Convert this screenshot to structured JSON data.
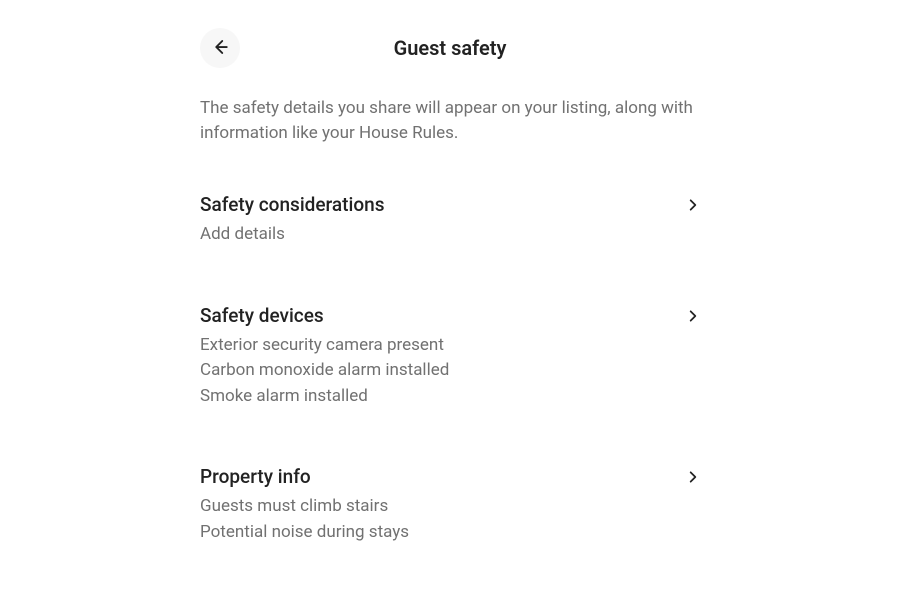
{
  "header": {
    "title": "Guest safety"
  },
  "description": "The safety details you share will appear on your listing, along with information like your House Rules.",
  "sections": [
    {
      "title": "Safety considerations",
      "details": [
        "Add details"
      ]
    },
    {
      "title": "Safety devices",
      "details": [
        "Exterior security camera present",
        "Carbon monoxide alarm installed",
        "Smoke alarm installed"
      ]
    },
    {
      "title": "Property info",
      "details": [
        "Guests must climb stairs",
        "Potential noise during stays"
      ]
    }
  ]
}
